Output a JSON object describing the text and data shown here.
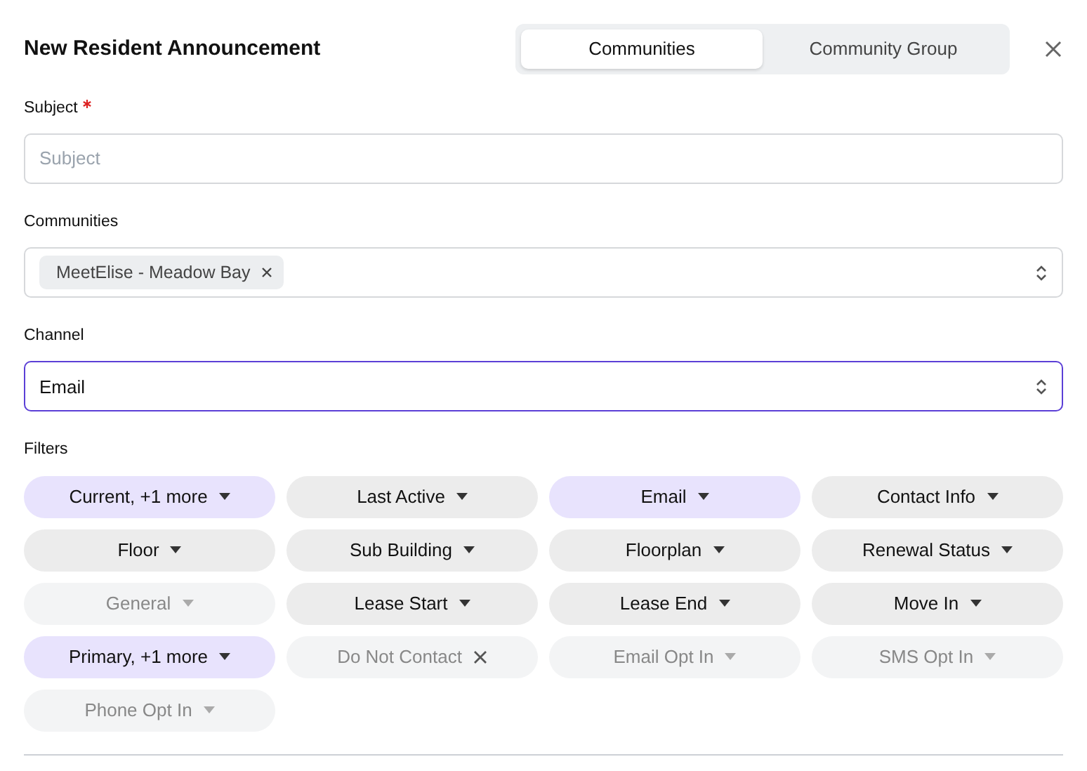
{
  "title": "New Resident Announcement",
  "tabs": [
    {
      "label": "Communities",
      "selected": true
    },
    {
      "label": "Community Group",
      "selected": false
    }
  ],
  "subject": {
    "label": "Subject",
    "required": true,
    "placeholder": "Subject"
  },
  "communities": {
    "label": "Communities",
    "chips": [
      "MeetElise - Meadow Bay"
    ]
  },
  "channel": {
    "label": "Channel",
    "value": "Email",
    "focused": true
  },
  "filters": {
    "label": "Filters",
    "items": [
      {
        "label": "Current, +1 more",
        "kind": "dropdown",
        "active": true,
        "disabled": false
      },
      {
        "label": "Last Active",
        "kind": "dropdown",
        "active": false,
        "disabled": false
      },
      {
        "label": "Email",
        "kind": "dropdown",
        "active": true,
        "disabled": false
      },
      {
        "label": "Contact Info",
        "kind": "dropdown",
        "active": false,
        "disabled": false
      },
      {
        "label": "Floor",
        "kind": "dropdown",
        "active": false,
        "disabled": false
      },
      {
        "label": "Sub Building",
        "kind": "dropdown",
        "active": false,
        "disabled": false
      },
      {
        "label": "Floorplan",
        "kind": "dropdown",
        "active": false,
        "disabled": false
      },
      {
        "label": "Renewal Status",
        "kind": "dropdown",
        "active": false,
        "disabled": false
      },
      {
        "label": "General",
        "kind": "dropdown",
        "active": false,
        "disabled": true
      },
      {
        "label": "Lease Start",
        "kind": "dropdown",
        "active": false,
        "disabled": false
      },
      {
        "label": "Lease End",
        "kind": "dropdown",
        "active": false,
        "disabled": false
      },
      {
        "label": "Move In",
        "kind": "dropdown",
        "active": false,
        "disabled": false
      },
      {
        "label": "Primary, +1 more",
        "kind": "dropdown",
        "active": true,
        "disabled": false
      },
      {
        "label": "Do Not Contact",
        "kind": "removable",
        "active": false,
        "disabled": true
      },
      {
        "label": "Email Opt In",
        "kind": "dropdown",
        "active": false,
        "disabled": true
      },
      {
        "label": "SMS Opt In",
        "kind": "dropdown",
        "active": false,
        "disabled": true
      },
      {
        "label": "Phone Opt In",
        "kind": "dropdown",
        "active": false,
        "disabled": true
      }
    ]
  }
}
